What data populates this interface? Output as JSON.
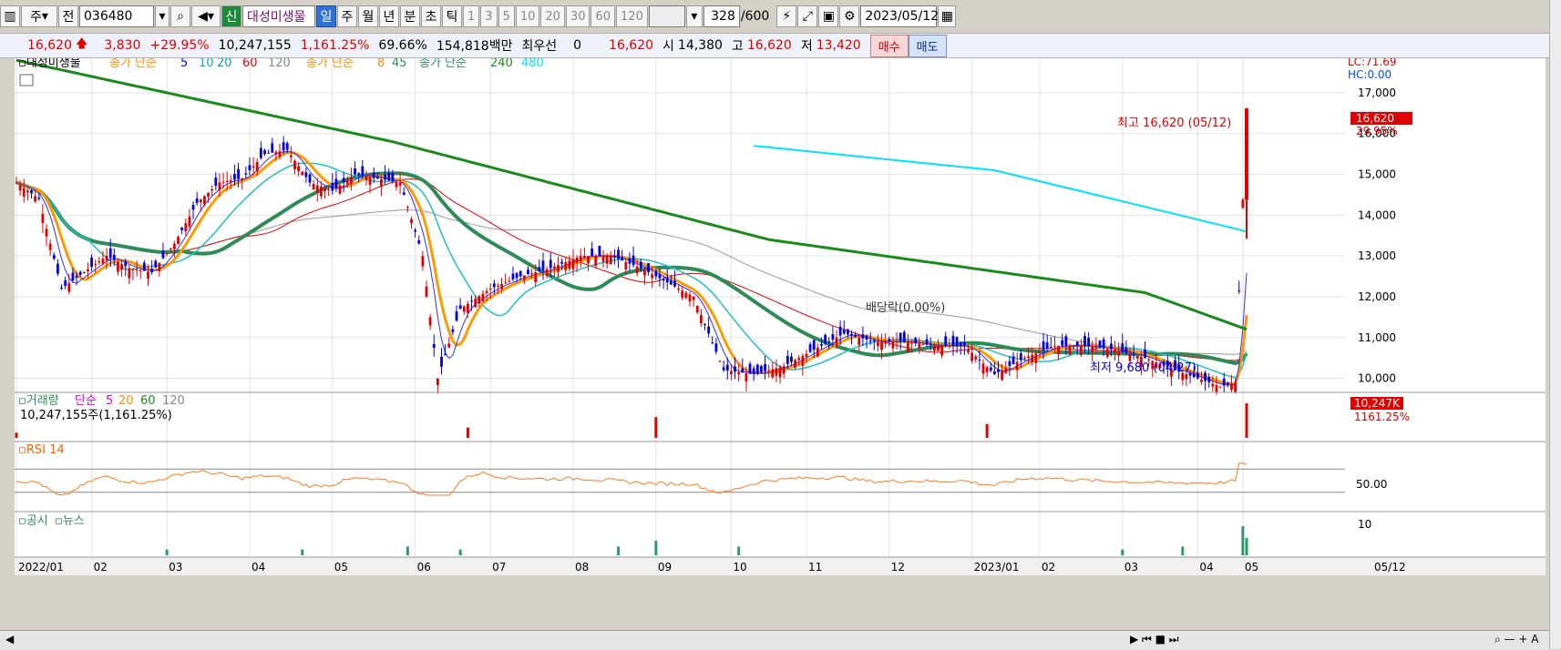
{
  "toolbar": {
    "market": "주",
    "prev": "전",
    "code": "036480",
    "new_badge": "신",
    "stock_name": "대성미생물",
    "periods": [
      "일",
      "주",
      "월",
      "년",
      "분",
      "초",
      "틱"
    ],
    "active_period": "일",
    "intervals": [
      "1",
      "3",
      "5",
      "10",
      "20",
      "30",
      "60",
      "120"
    ],
    "count": "328",
    "count_total": "/600",
    "date": "2023/05/12"
  },
  "quote": {
    "price": "16,620",
    "change": "3,830",
    "change_pct": "+29.95%",
    "volume": "10,247,155",
    "volume_pct": "1,161.25%",
    "turnover": "69.66%",
    "amount": "154,818백만",
    "pref_label": "최우선",
    "pref_value": "0",
    "bid": "16,620",
    "open_label": "시",
    "open": "14,380",
    "high_label": "고",
    "high": "16,620",
    "low_label": "저",
    "low": "13,420",
    "buy": "매수",
    "sell": "매도"
  },
  "chart_data": {
    "type": "candlestick",
    "title": "대성미생물",
    "legend": {
      "ma_group1_label": "종가 단순",
      "ma_group1": [
        "5",
        "10",
        "20",
        "60",
        "120"
      ],
      "ma_group2_label": "종가 단순",
      "ma_group2": [
        "8",
        "45"
      ],
      "ma_group3_label": "종가 단순",
      "ma_group3": [
        "240",
        "480"
      ]
    },
    "price_axis": {
      "ticks": [
        "17,000",
        "16,000",
        "15,000",
        "14,000",
        "13,000",
        "12,000",
        "11,000",
        "10,000"
      ],
      "ylim": [
        9700,
        17400
      ]
    },
    "lc_label": "LC:71.69",
    "hc_label": "HC:0.00",
    "last_price_label": "16,620",
    "last_pct_label": "29.95%",
    "annotations": {
      "high": "최고 16,620 (05/12)",
      "low": "최저 9,680 (04/27)",
      "dividend": "배당락(0.00%)"
    },
    "x_labels": [
      "2022/01",
      "02",
      "03",
      "04",
      "05",
      "06",
      "07",
      "08",
      "09",
      "10",
      "11",
      "12",
      "2023/01",
      "02",
      "03",
      "04",
      "05"
    ],
    "x_end_label": "05/12",
    "close_path": [
      [
        0,
        14800
      ],
      [
        6,
        14400
      ],
      [
        12,
        12200
      ],
      [
        18,
        12600
      ],
      [
        24,
        13000
      ],
      [
        30,
        12700
      ],
      [
        36,
        12600
      ],
      [
        42,
        13300
      ],
      [
        48,
        14300
      ],
      [
        54,
        14800
      ],
      [
        60,
        14900
      ],
      [
        66,
        15500
      ],
      [
        72,
        15600
      ],
      [
        78,
        14800
      ],
      [
        84,
        14600
      ],
      [
        90,
        15000
      ],
      [
        96,
        14900
      ],
      [
        102,
        14800
      ],
      [
        108,
        13000
      ],
      [
        112,
        10000
      ],
      [
        118,
        11700
      ],
      [
        126,
        12200
      ],
      [
        134,
        12500
      ],
      [
        142,
        12700
      ],
      [
        150,
        13000
      ],
      [
        158,
        13000
      ],
      [
        166,
        12700
      ],
      [
        174,
        12300
      ],
      [
        180,
        12000
      ],
      [
        188,
        10200
      ],
      [
        196,
        10100
      ],
      [
        204,
        10300
      ],
      [
        212,
        10700
      ],
      [
        220,
        11100
      ],
      [
        228,
        10900
      ],
      [
        236,
        10900
      ],
      [
        244,
        10800
      ],
      [
        252,
        10800
      ],
      [
        260,
        10100
      ],
      [
        268,
        10500
      ],
      [
        276,
        10800
      ],
      [
        284,
        10800
      ],
      [
        292,
        10700
      ],
      [
        300,
        10500
      ],
      [
        308,
        10200
      ],
      [
        314,
        10000
      ],
      [
        320,
        9800
      ],
      [
        324,
        9900
      ],
      [
        327,
        16620
      ]
    ],
    "ma240": [
      [
        0,
        17800
      ],
      [
        100,
        15800
      ],
      [
        200,
        13400
      ],
      [
        300,
        12100
      ],
      [
        327,
        11200
      ]
    ],
    "ma480": [
      [
        196,
        15700
      ],
      [
        260,
        15100
      ],
      [
        327,
        13600
      ]
    ],
    "volume": {
      "label": "거래량",
      "ma_label": "단순",
      "ma": [
        "5",
        "20",
        "60",
        "120"
      ],
      "last": "10,247,155주(1,161.25%)",
      "last_tag": "10,247K",
      "last_pct": "1161.25%"
    },
    "rsi": {
      "label": "RSI 14",
      "tick": "50.00",
      "last": 78
    },
    "news": {
      "labels": [
        "공시",
        "뉴스"
      ],
      "tick": "10"
    }
  }
}
